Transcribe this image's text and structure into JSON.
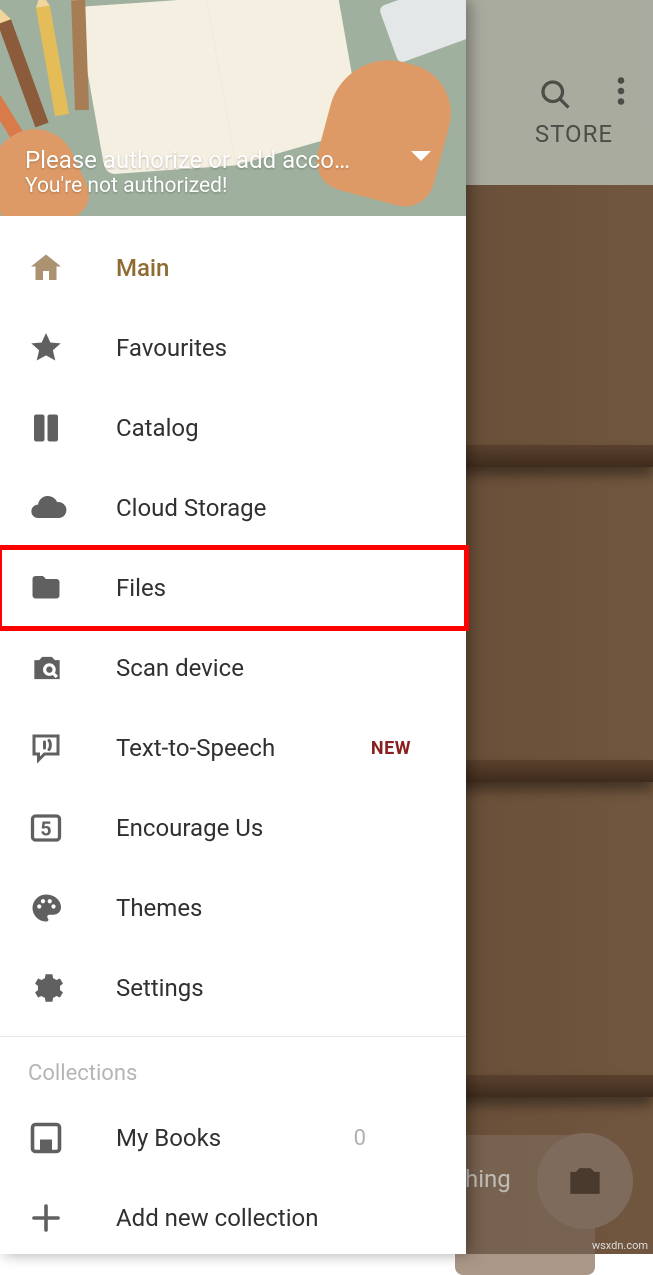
{
  "topbar": {
    "store_label": "STORE"
  },
  "tooltip": {
    "text": "hing"
  },
  "drawer": {
    "auth_title": "Please authorize or add acco…",
    "auth_subtitle": "You're not authorized!"
  },
  "menu": [
    {
      "icon": "home",
      "label": "Main",
      "active": true
    },
    {
      "icon": "star",
      "label": "Favourites"
    },
    {
      "icon": "catalog",
      "label": "Catalog"
    },
    {
      "icon": "cloud",
      "label": "Cloud Storage"
    },
    {
      "icon": "folder",
      "label": "Files",
      "highlighted": true
    },
    {
      "icon": "scan",
      "label": "Scan device"
    },
    {
      "icon": "tts",
      "label": "Text-to-Speech",
      "badge": "NEW"
    },
    {
      "icon": "encourage",
      "label": "Encourage Us"
    },
    {
      "icon": "themes",
      "label": "Themes"
    },
    {
      "icon": "settings",
      "label": "Settings"
    }
  ],
  "collections": {
    "header": "Collections",
    "items": [
      {
        "icon": "mybooks",
        "label": "My Books",
        "count": "0"
      },
      {
        "icon": "plus",
        "label": "Add new collection"
      }
    ]
  },
  "watermark": "wsxdn.com"
}
